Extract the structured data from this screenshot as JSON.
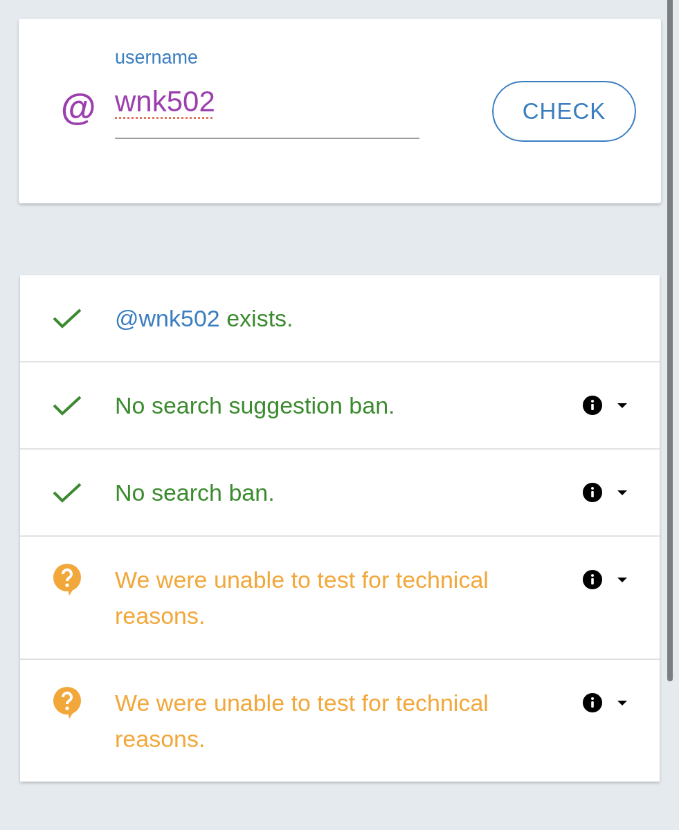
{
  "username_form": {
    "prefix": "@",
    "label": "username",
    "value": "wnk502",
    "spelling_error": true,
    "button": "CHECK"
  },
  "results": [
    {
      "kind": "passed",
      "handle": "@wnk502",
      "text": "exists."
    },
    {
      "kind": "passed",
      "text": "No search suggestion ban.",
      "details": {
        "expanded": false
      }
    },
    {
      "kind": "passed",
      "text": "No search ban.",
      "details": {
        "expanded": false
      }
    },
    {
      "kind": "unknown",
      "text": "We were unable to test for technical reasons.",
      "details": {
        "expanded": false
      }
    },
    {
      "kind": "unknown",
      "text": "We were unable to test for technical reasons.",
      "details": {
        "expanded": false
      }
    }
  ]
}
